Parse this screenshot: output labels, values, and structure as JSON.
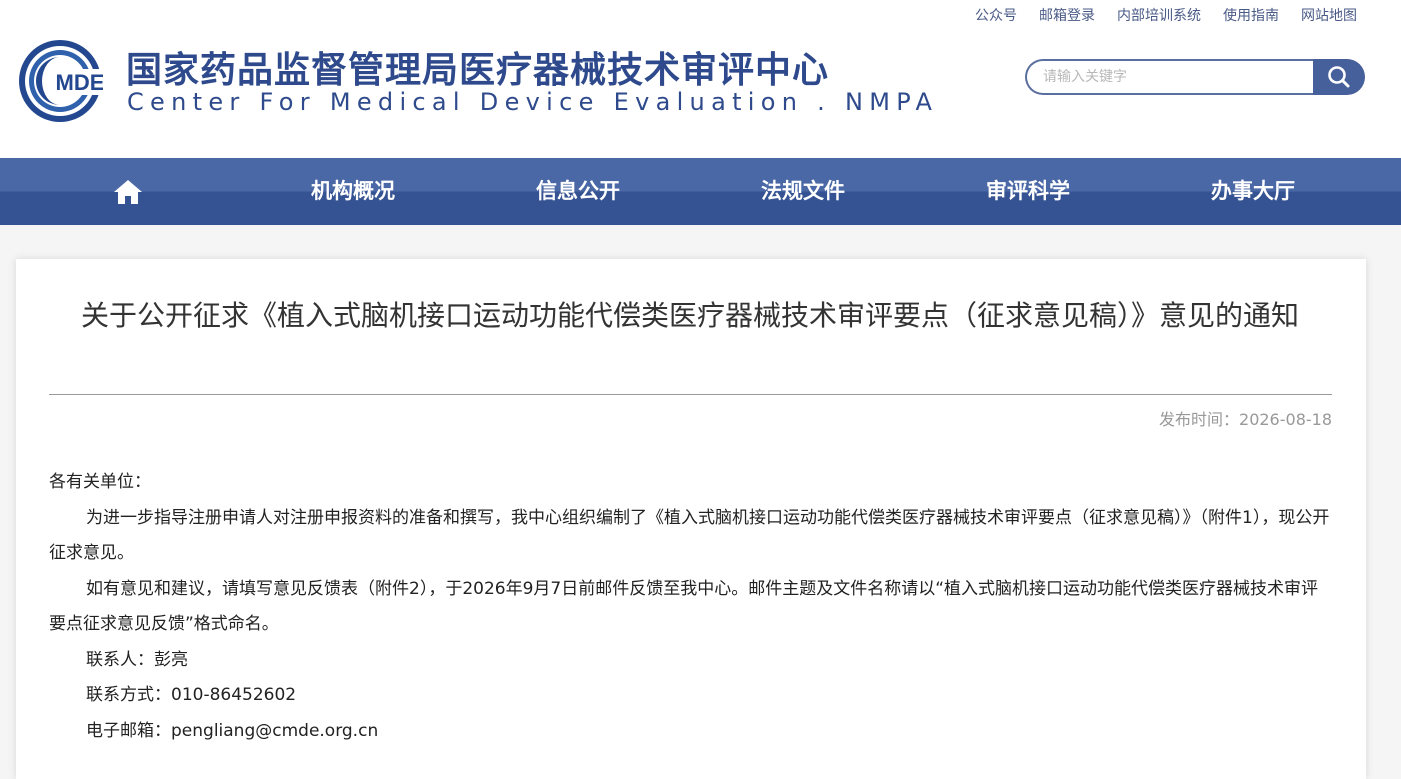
{
  "header": {
    "top_links": [
      "公众号",
      "邮箱登录",
      "内部培训系统",
      "使用指南",
      "网站地图"
    ],
    "logo_text": "MDE",
    "title_cn": "国家药品监督管理局医疗器械技术审评中心",
    "title_en": "Center For Medical Device Evaluation . NMPA",
    "search_placeholder": "请输入关键字"
  },
  "nav": {
    "home_icon": "home-icon",
    "items": [
      "机构概况",
      "信息公开",
      "法规文件",
      "审评科学",
      "办事大厅"
    ]
  },
  "article": {
    "title": "关于公开征求《植入式脑机接口运动功能代偿类医疗器械技术审评要点（征求意见稿）》意见的通知",
    "pubdate_label": "发布时间：",
    "pubdate_value": "2026-08-18",
    "salutation": "各有关单位：",
    "paragraph1": "为进一步指导注册申请人对注册申报资料的准备和撰写，我中心组织编制了《植入式脑机接口运动功能代偿类医疗器械技术审评要点（征求意见稿）》（附件1），现公开征求意见。",
    "paragraph2": "如有意见和建议，请填写意见反馈表（附件2），于2026年9月7日前邮件反馈至我中心。邮件主题及文件名称请以“植入式脑机接口运动功能代偿类医疗器械技术审评要点征求意见反馈”格式命名。",
    "contact": "联系人：彭亮",
    "phone": "联系方式：010-86452602",
    "email": "电子邮箱：pengliang@cmde.org.cn"
  },
  "colors": {
    "brand_blue": "#2e4a8c",
    "nav_top": "#4a67a6",
    "nav_bottom": "#355392",
    "logo_ring": "#2f61ad"
  }
}
